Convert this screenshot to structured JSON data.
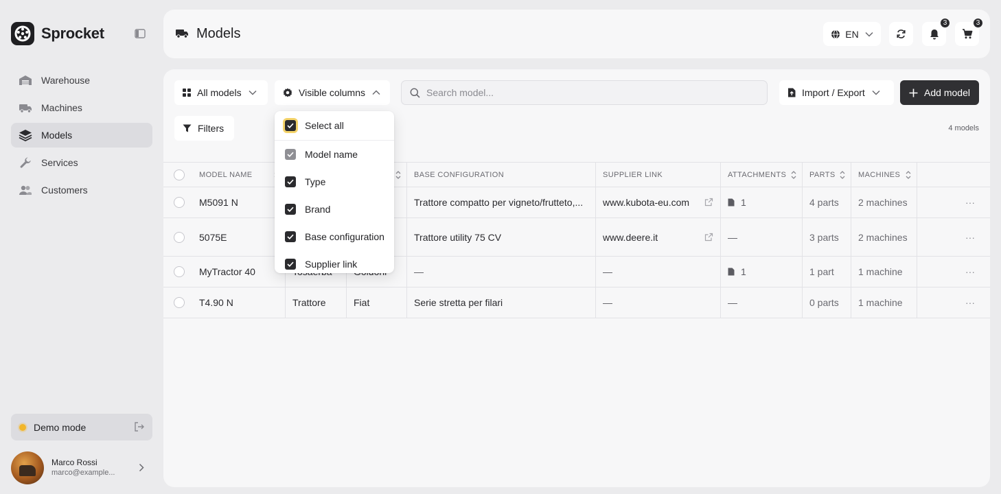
{
  "app": {
    "name": "Sprocket"
  },
  "sidebar": {
    "items": [
      {
        "label": "Warehouse",
        "icon": "warehouse-icon",
        "active": false
      },
      {
        "label": "Machines",
        "icon": "truck-icon",
        "active": false
      },
      {
        "label": "Models",
        "icon": "layers-icon",
        "active": true
      },
      {
        "label": "Services",
        "icon": "wrench-icon",
        "active": false
      },
      {
        "label": "Customers",
        "icon": "users-icon",
        "active": false
      }
    ],
    "demo_label": "Demo mode",
    "user": {
      "name": "Marco Rossi",
      "email": "marco@example..."
    }
  },
  "header": {
    "title": "Models",
    "language": "EN",
    "notifications_count": "3",
    "cart_count": "3"
  },
  "toolbar": {
    "all_models": "All models",
    "visible_columns": "Visible columns",
    "search_placeholder": "Search model...",
    "import_export": "Import / Export",
    "add_model": "Add model",
    "filters": "Filters",
    "count": "4 models"
  },
  "columns_dropdown": {
    "select_all": "Select all",
    "options": [
      {
        "label": "Model name",
        "checked": true,
        "locked": true
      },
      {
        "label": "Type",
        "checked": true
      },
      {
        "label": "Brand",
        "checked": true
      },
      {
        "label": "Base configuration",
        "checked": true
      },
      {
        "label": "Supplier link",
        "checked": true
      }
    ]
  },
  "table": {
    "headers": {
      "name": "MODEL NAME",
      "base": "BASE CONFIGURATION",
      "link": "SUPPLIER LINK",
      "attachments": "ATTACHMENTS",
      "parts": "PARTS",
      "machines": "MACHINES"
    },
    "rows": [
      {
        "name": "M5091 N",
        "type": "",
        "brand": "",
        "base": "Trattore compatto per vigneto/frutteto,...",
        "link": "www.kubota-eu.com",
        "attachments": "1",
        "parts": "4 parts",
        "machines": "2 machines"
      },
      {
        "name": "5075E",
        "type": "",
        "brand": "",
        "base": "Trattore utility 75 CV",
        "link": "www.deere.it",
        "attachments": "—",
        "parts": "3 parts",
        "machines": "2 machines"
      },
      {
        "name": "MyTractor 40",
        "type": "Tosaerba",
        "brand": "Goldoni",
        "base": "—",
        "link": "—",
        "attachments": "1",
        "parts": "1 part",
        "machines": "1 machine"
      },
      {
        "name": "T4.90 N",
        "type": "Trattore",
        "brand": "Fiat",
        "base": "Serie stretta per filari",
        "link": "—",
        "attachments": "—",
        "parts": "0 parts",
        "machines": "1 machine"
      }
    ],
    "row_action": "···"
  }
}
